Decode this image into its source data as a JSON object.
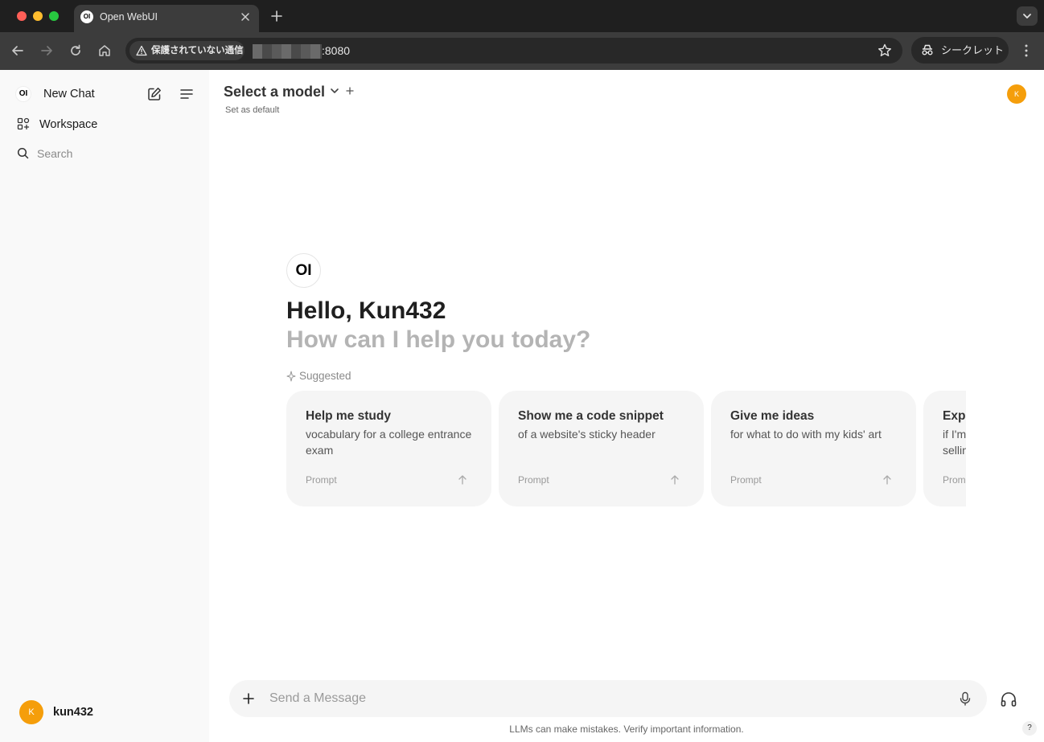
{
  "browser": {
    "tab_title": "Open WebUI",
    "tab_favicon": "OI",
    "security_label": "保護されていない通信",
    "url_visible": ":8080",
    "incognito_label": "シークレット"
  },
  "sidebar": {
    "logo": "OI",
    "new_chat": "New Chat",
    "workspace": "Workspace",
    "search": "Search",
    "user": {
      "avatar_initial": "K",
      "name": "kun432"
    }
  },
  "header": {
    "model_select": "Select a model",
    "set_default": "Set as default",
    "avatar_initial": "K"
  },
  "hero": {
    "logo": "OI",
    "greeting": "Hello, Kun432",
    "subtitle": "How can I help you today?",
    "suggested_label": "Suggested"
  },
  "suggestions": [
    {
      "title": "Help me study",
      "desc": "vocabulary for a college entrance exam",
      "tag": "Prompt"
    },
    {
      "title": "Show me a code snippet",
      "desc": "of a website's sticky header",
      "tag": "Prompt"
    },
    {
      "title": "Give me ideas",
      "desc": "for what to do with my kids' art",
      "tag": "Prompt"
    },
    {
      "title": "Explain options trading",
      "desc": "if I'm familiar with buying and selling stocks",
      "tag": "Prompt"
    }
  ],
  "composer": {
    "placeholder": "Send a Message",
    "disclaimer": "LLMs can make mistakes. Verify important information.",
    "help": "?"
  },
  "colors": {
    "accent_avatar": "#f59e0b",
    "sidebar_bg": "#f9f9f9",
    "card_bg": "#f5f5f5"
  }
}
